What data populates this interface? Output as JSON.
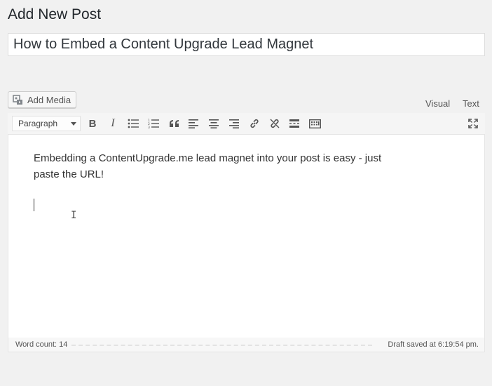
{
  "page": {
    "title": "Add New Post"
  },
  "post": {
    "title": "How to Embed a Content Upgrade Lead Magnet"
  },
  "media": {
    "add_label": "Add Media",
    "icon": "add-media-icon"
  },
  "modes": {
    "visual": "Visual",
    "text": "Text"
  },
  "toolbar": {
    "format_value": "Paragraph",
    "buttons": [
      "bold-icon",
      "italic-icon",
      "bullet-list-icon",
      "numbered-list-icon",
      "blockquote-icon",
      "align-left-icon",
      "align-center-icon",
      "align-right-icon",
      "insert-link-icon",
      "remove-link-icon",
      "read-more-icon",
      "toolbar-toggle-icon",
      "fullscreen-icon"
    ]
  },
  "editor": {
    "content": "Embedding a ContentUpgrade.me lead magnet into your post is easy - just paste the URL!"
  },
  "status": {
    "word_count": "Word count: 14",
    "draft_saved": "Draft saved at 6:19:54 pm."
  }
}
